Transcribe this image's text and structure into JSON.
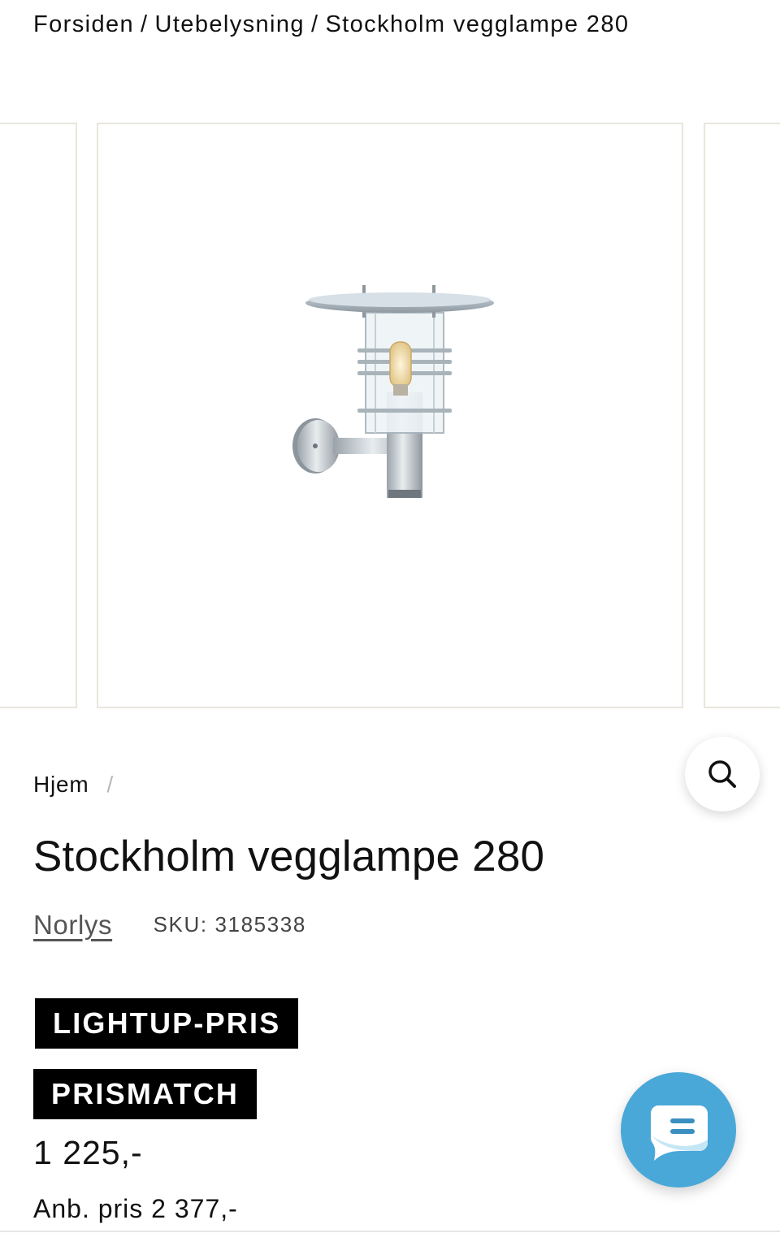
{
  "breadcrumb_top": {
    "items": [
      "Forsiden",
      "Utebelysning",
      "Stockholm vegglampe 280"
    ],
    "separator": "/"
  },
  "gallery": {
    "image_alt": "Stockholm vegglampe 280",
    "zoom_icon": "search-icon"
  },
  "breadcrumb_product": {
    "home": "Hjem",
    "separator": "/"
  },
  "product": {
    "title": "Stockholm vegglampe 280",
    "brand": "Norlys",
    "sku": "SKU: 3185338",
    "badges": [
      "LIGHTUP-PRIS",
      "PRISMATCH"
    ],
    "price": "1 225,-",
    "recommended_price": "Anb. pris 2 377,-"
  },
  "chat": {
    "icon": "chat-bubble-icon",
    "color": "#4aa8d8"
  },
  "colors": {
    "text": "#111111",
    "badge_bg": "#000000",
    "slide_border": "#e9e6db",
    "chat": "#4aa8d8"
  }
}
